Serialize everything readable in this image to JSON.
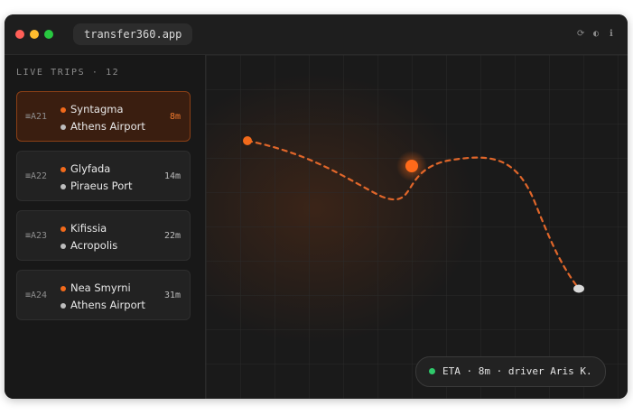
{
  "app": {
    "url": "transfer360.app"
  },
  "window_controls": {
    "icons": [
      "refresh-icon",
      "contrast-icon",
      "info-icon"
    ],
    "glyphs": [
      "⟳",
      "◐",
      "ℹ"
    ]
  },
  "sidebar": {
    "title": "LIVE TRIPS · 12",
    "trips": [
      {
        "code": "≡A21",
        "from": "Syntagma",
        "to": "Athens Airport",
        "eta": "8m",
        "active": true
      },
      {
        "code": "≡A22",
        "from": "Glyfada",
        "to": "Piraeus Port",
        "eta": "14m",
        "active": false
      },
      {
        "code": "≡A23",
        "from": "Kifissia",
        "to": "Acropolis",
        "eta": "22m",
        "active": false
      },
      {
        "code": "≡A24",
        "from": "Nea Smyrni",
        "to": "Athens Airport",
        "eta": "31m",
        "active": false
      }
    ]
  },
  "map": {
    "status": "ETA · 8m · driver Aris K.",
    "colors": {
      "route": "#e0662a",
      "origin": "#f26a1b",
      "vehicle": "#ff6a1a",
      "destination": "#d9d9d9",
      "live": "#2fc96b"
    }
  }
}
